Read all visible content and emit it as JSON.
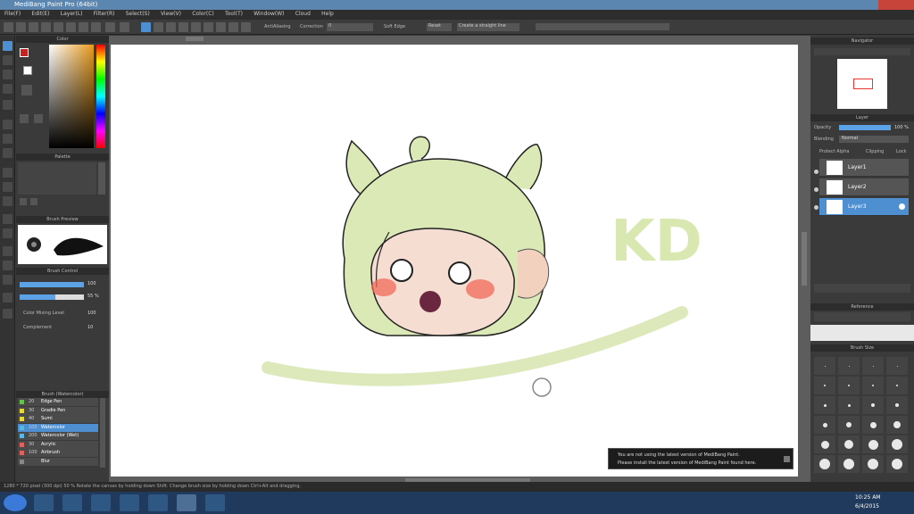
{
  "window": {
    "title": "MediBang Paint Pro (64bit)"
  },
  "menu": [
    "File(F)",
    "Edit(E)",
    "Layer(L)",
    "Filter(R)",
    "Select(S)",
    "View(V)",
    "Color(C)",
    "Tool(T)",
    "Window(W)",
    "Cloud",
    "Help"
  ],
  "toolbar": {
    "antialias_label": "AntiAliasing",
    "correction_label": "Correction",
    "correction_value": "0",
    "soft_edge_label": "Soft Edge",
    "reset_label": "Reset",
    "create_label": "Create a straight line"
  },
  "left": {
    "color_title": "Color",
    "palette_title": "Palette",
    "brush_preview_title": "Brush Preview",
    "brush_control_title": "Brush Control",
    "size_value": "100",
    "opacity_value": "55 %",
    "color_mixing_label": "Color Mixing Level",
    "color_mixing_value": "100",
    "complement_label": "Complement",
    "complement_value": "10",
    "brush_title": "Brush (Watercolor)",
    "brushes": [
      {
        "size": "20",
        "name": "Edge Pen",
        "color": "#66c24a"
      },
      {
        "size": "30",
        "name": "Gradie Pen",
        "color": "#e6d838"
      },
      {
        "size": "40",
        "name": "Sumi",
        "color": "#e6d838"
      },
      {
        "size": "100",
        "name": "Watercolor",
        "color": "#59b8e6"
      },
      {
        "size": "200",
        "name": "Watercolor (Wet)",
        "color": "#59b8e6"
      },
      {
        "size": "30",
        "name": "Acrylic",
        "color": "#e65f5f"
      },
      {
        "size": "100",
        "name": "Airbrush",
        "color": "#e65f5f"
      },
      {
        "size": "",
        "name": "Blur",
        "color": "#888888"
      }
    ]
  },
  "right": {
    "navigator_title": "Navigator",
    "layer_title": "Layer",
    "opacity_label": "Opacity",
    "opacity_value": "100 %",
    "blending_label": "Blending",
    "blending_value": "Normal",
    "protect_alpha_label": "Protect Alpha",
    "clipping_label": "Clipping",
    "lock_label": "Lock",
    "layers": [
      "Layer1",
      "Layer2",
      "Layer3"
    ],
    "reference_title": "Reference",
    "brush_size_title": "Brush Size"
  },
  "canvas_text": "KD",
  "status": "1280 * 720 pixel  (300 dpi)  50 %  Rotate the canvas by holding down Shift. Change brush size by holding down Ctrl+Alt and dragging.",
  "toast": {
    "line1": "You are not using the latest version of MediBang Paint.",
    "line2": "Please install the latest version of MediBang Paint found here."
  },
  "clock": {
    "time": "10:25 AM",
    "date": "6/4/2015"
  },
  "colors": {
    "accent": "#4d8fd1",
    "sketch_green": "#d4e6a8",
    "blush": "#f06a5a",
    "skin": "#f6ddd2"
  }
}
